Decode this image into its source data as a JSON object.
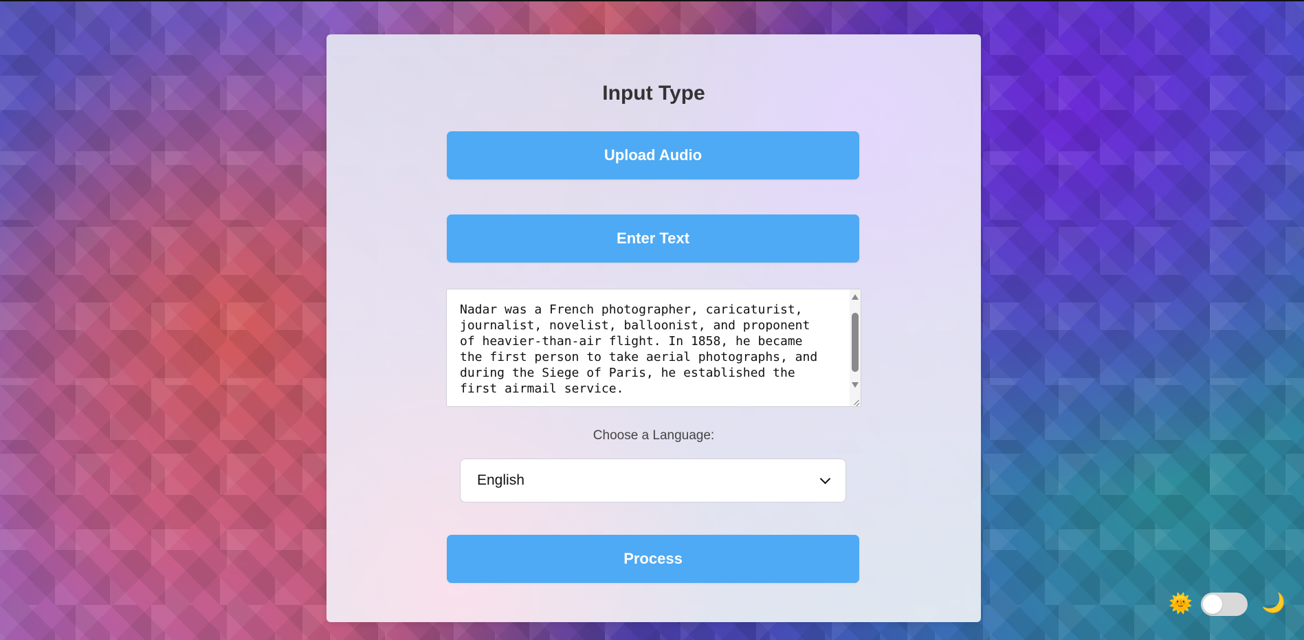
{
  "theme": {
    "button_color": "#4eaaf4",
    "title_color": "#333333",
    "toggle_state": "light",
    "sun_icon": "sun-icon",
    "moon_icon": "moon-icon"
  },
  "card": {
    "title": "Input Type",
    "buttons": {
      "upload_audio": "Upload Audio",
      "enter_text": "Enter Text",
      "process": "Process"
    },
    "text_input": {
      "value": "Nadar was a French photographer, caricaturist,\njournalist, novelist, balloonist, and proponent\nof heavier-than-air flight. In 1858, he became\nthe first person to take aerial photographs, and\nduring the Siege of Paris, he established the\nfirst airmail service."
    },
    "language": {
      "label": "Choose a Language:",
      "selected": "English"
    }
  },
  "icons": {
    "sun": "🌞",
    "moon": "🌙",
    "dropdown": "chevron-down-icon"
  }
}
